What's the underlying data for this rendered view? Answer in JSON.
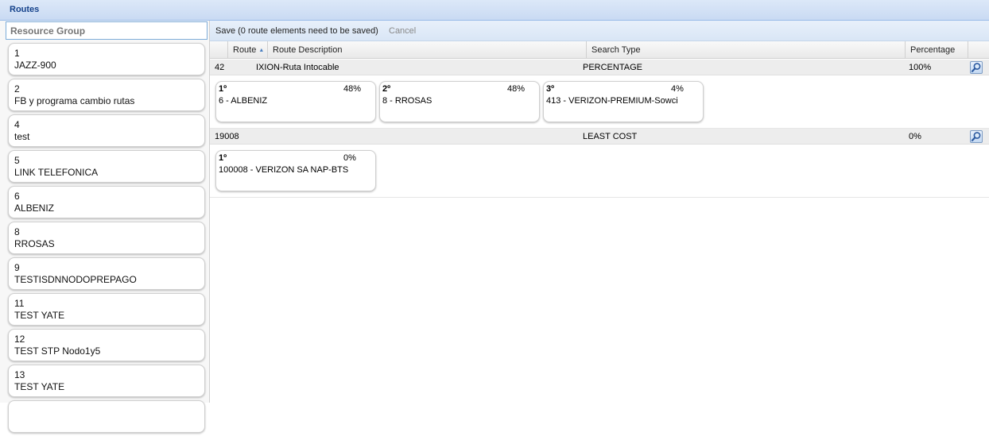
{
  "panel_title": "Routes",
  "resource_group": {
    "placeholder": "Resource Group"
  },
  "resource_groups": [
    {
      "id": "1",
      "name": "JAZZ-900"
    },
    {
      "id": "2",
      "name": "FB y programa cambio rutas"
    },
    {
      "id": "4",
      "name": "test"
    },
    {
      "id": "5",
      "name": "LINK TELEFONICA"
    },
    {
      "id": "6",
      "name": "ALBENIZ"
    },
    {
      "id": "8",
      "name": "RROSAS"
    },
    {
      "id": "9",
      "name": "TESTISDNNODOPREPAGO"
    },
    {
      "id": "11",
      "name": "TEST YATE"
    },
    {
      "id": "12",
      "name": "TEST STP Nodo1y5"
    },
    {
      "id": "13",
      "name": "TEST YATE"
    }
  ],
  "toolbar": {
    "save_label": "Save (0 route elements need to be saved)",
    "cancel_label": "Cancel"
  },
  "columns": {
    "route": "Route",
    "description": "Route Description",
    "search_type": "Search Type",
    "percentage": "Percentage"
  },
  "routes": [
    {
      "route": "42",
      "description": "IXION-Ruta Intocable",
      "search_type": "PERCENTAGE",
      "percentage": "100%",
      "elements": [
        {
          "order": "1º",
          "percent": "48%",
          "name": "6 - ALBENIZ"
        },
        {
          "order": "2º",
          "percent": "48%",
          "name": "8 - RROSAS"
        },
        {
          "order": "3º",
          "percent": "4%",
          "name": "413 - VERIZON-PREMIUM-Sowci"
        }
      ]
    },
    {
      "route": "19008",
      "description": "",
      "search_type": "LEAST COST",
      "percentage": "0%",
      "elements": [
        {
          "order": "1º",
          "percent": "0%",
          "name": "100008 - VERIZON SA NAP-BTS"
        }
      ]
    }
  ],
  "colors": {
    "accent": "#15428b",
    "header_border": "#99bbe8",
    "row_bg": "#ededed"
  },
  "icons": {
    "search": "magnifier-icon",
    "sort": "sort-ascending-icon"
  }
}
